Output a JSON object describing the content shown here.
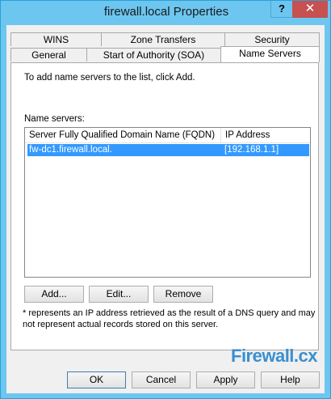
{
  "window": {
    "title": "firewall.local Properties",
    "help_button": "?",
    "close_button": "✕"
  },
  "tabs": {
    "row_top": [
      "WINS",
      "Zone Transfers",
      "Security"
    ],
    "row_bottom": [
      "General",
      "Start of Authority (SOA)",
      "Name Servers"
    ],
    "active": "Name Servers"
  },
  "panel": {
    "instruction": "To add name servers to the list, click Add.",
    "list_label": "Name servers:",
    "columns": [
      "Server Fully Qualified Domain Name (FQDN)",
      "IP Address"
    ],
    "rows": [
      {
        "fqdn": "fw-dc1.firewall.local.",
        "ip": "[192.168.1.1]",
        "selected": true
      }
    ],
    "add_button": "Add...",
    "edit_button": "Edit...",
    "remove_button": "Remove",
    "footnote_line1": "* represents an IP address retrieved as the result of a DNS query and may",
    "footnote_line2": "not represent actual records stored on this server."
  },
  "footer": {
    "logo_text": "Firewall.cx",
    "ok_button": "OK",
    "cancel_button": "Cancel",
    "apply_button": "Apply",
    "help_button": "Help"
  },
  "colors": {
    "titlebar": "#6cc6f0",
    "close": "#c75050",
    "selection": "#3399ff",
    "logo": "#3a8fd0"
  }
}
